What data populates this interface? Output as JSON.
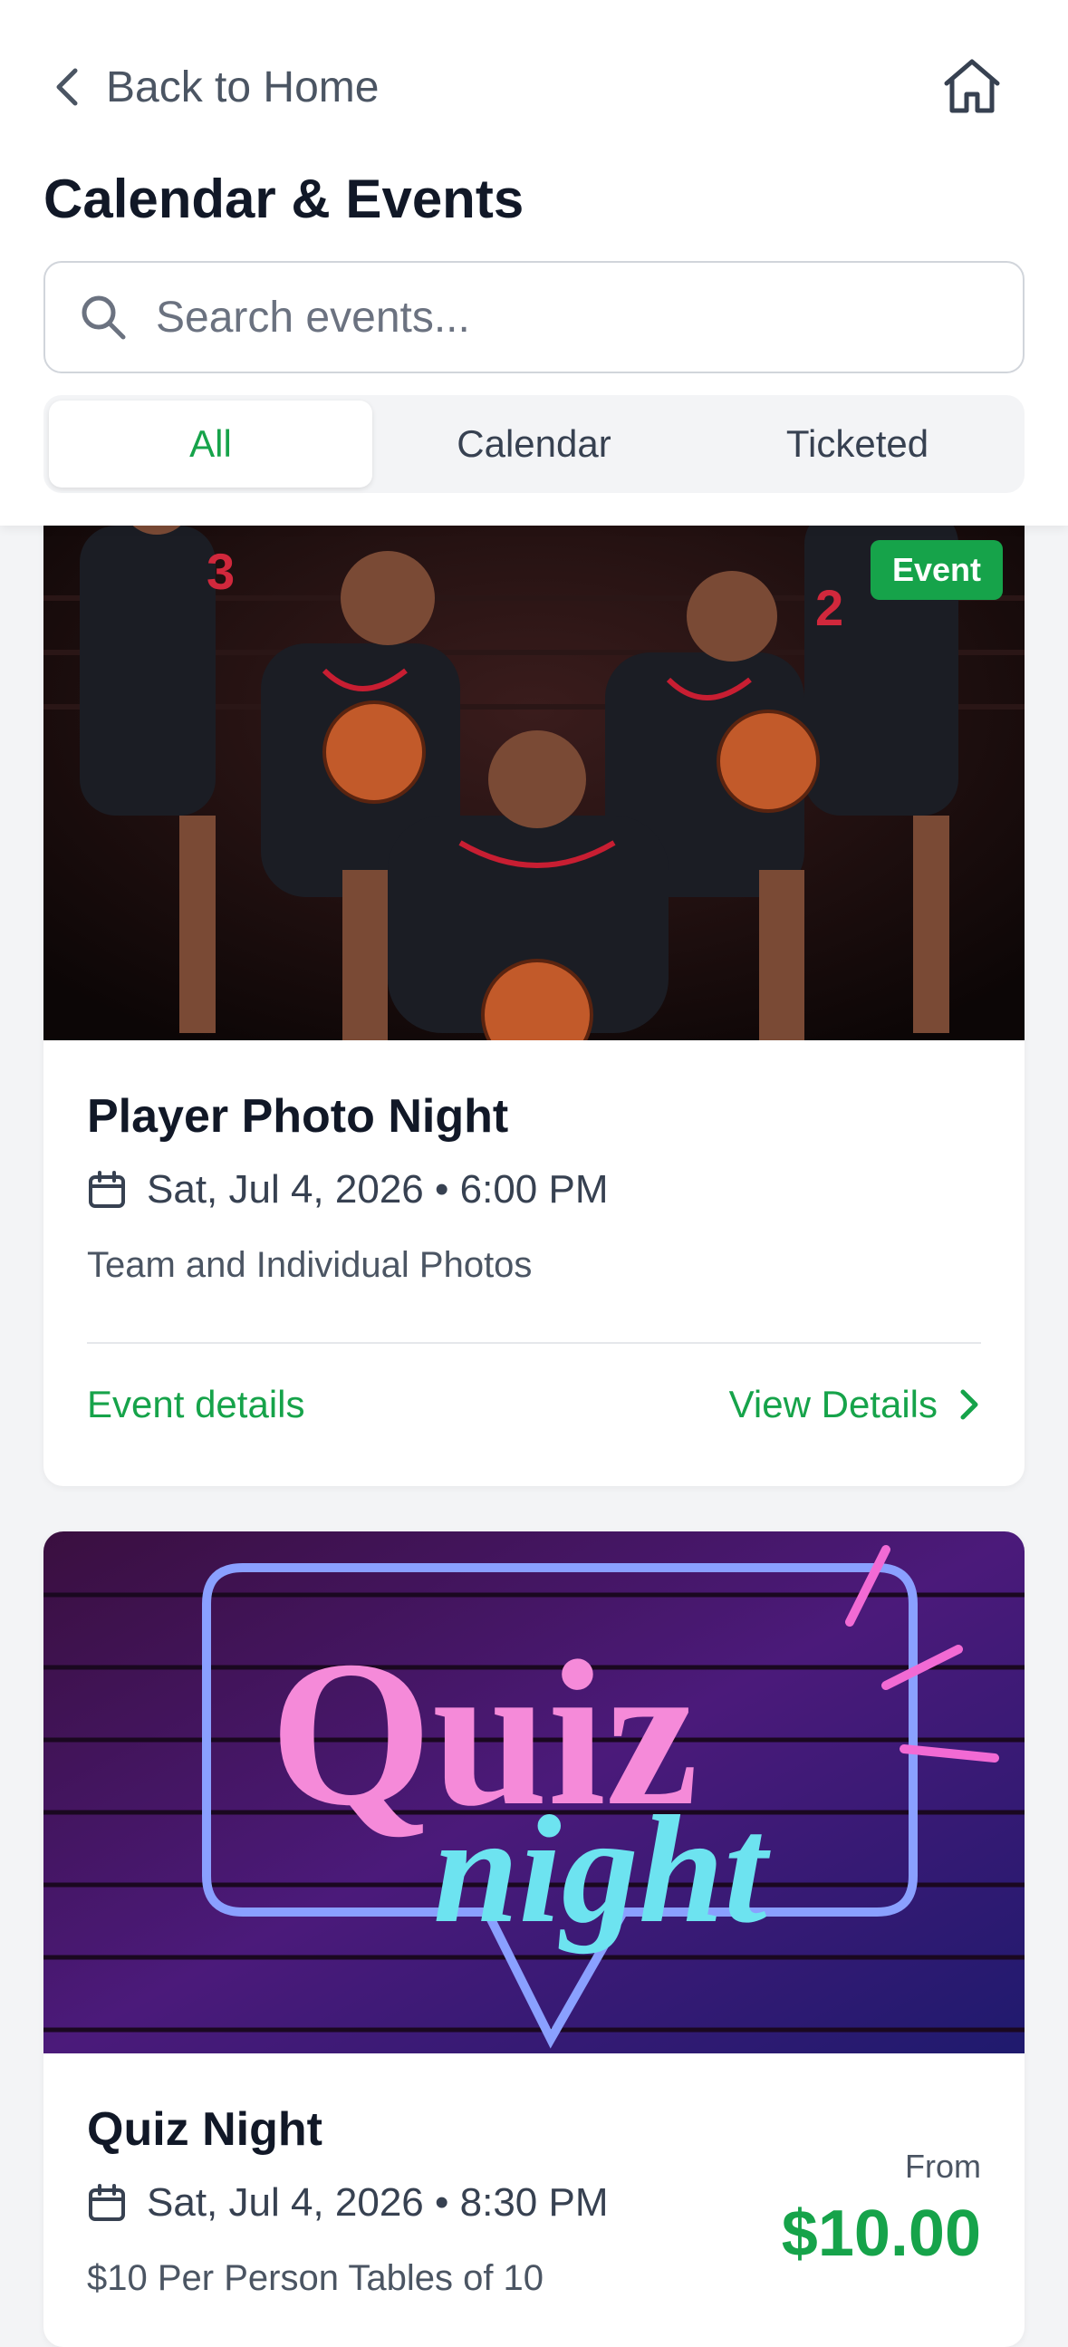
{
  "header": {
    "back_label": "Back to Home",
    "title": "Calendar & Events"
  },
  "search": {
    "placeholder": "Search events..."
  },
  "tabs": [
    {
      "label": "All",
      "active": true
    },
    {
      "label": "Calendar",
      "active": false
    },
    {
      "label": "Ticketed",
      "active": false
    }
  ],
  "events": [
    {
      "badge": "Event",
      "image_icon": "team-photo-image",
      "title": "Player Photo Night",
      "date": "Sat, Jul 4, 2026 • 6:00 PM",
      "description": "Team and Individual Photos",
      "footer_left": "Event details",
      "footer_right": "View Details"
    },
    {
      "image_icon": "quiz-night-neon-image",
      "image_text_1": "Quiz",
      "image_text_2": "night",
      "title": "Quiz Night",
      "date": "Sat, Jul 4, 2026 • 8:30 PM",
      "description": "$10 Per Person Tables of 10",
      "price_label": "From",
      "price": "$10.00"
    }
  ],
  "colors": {
    "accent": "#16a34a",
    "text": "#111827",
    "muted": "#4b5563"
  }
}
